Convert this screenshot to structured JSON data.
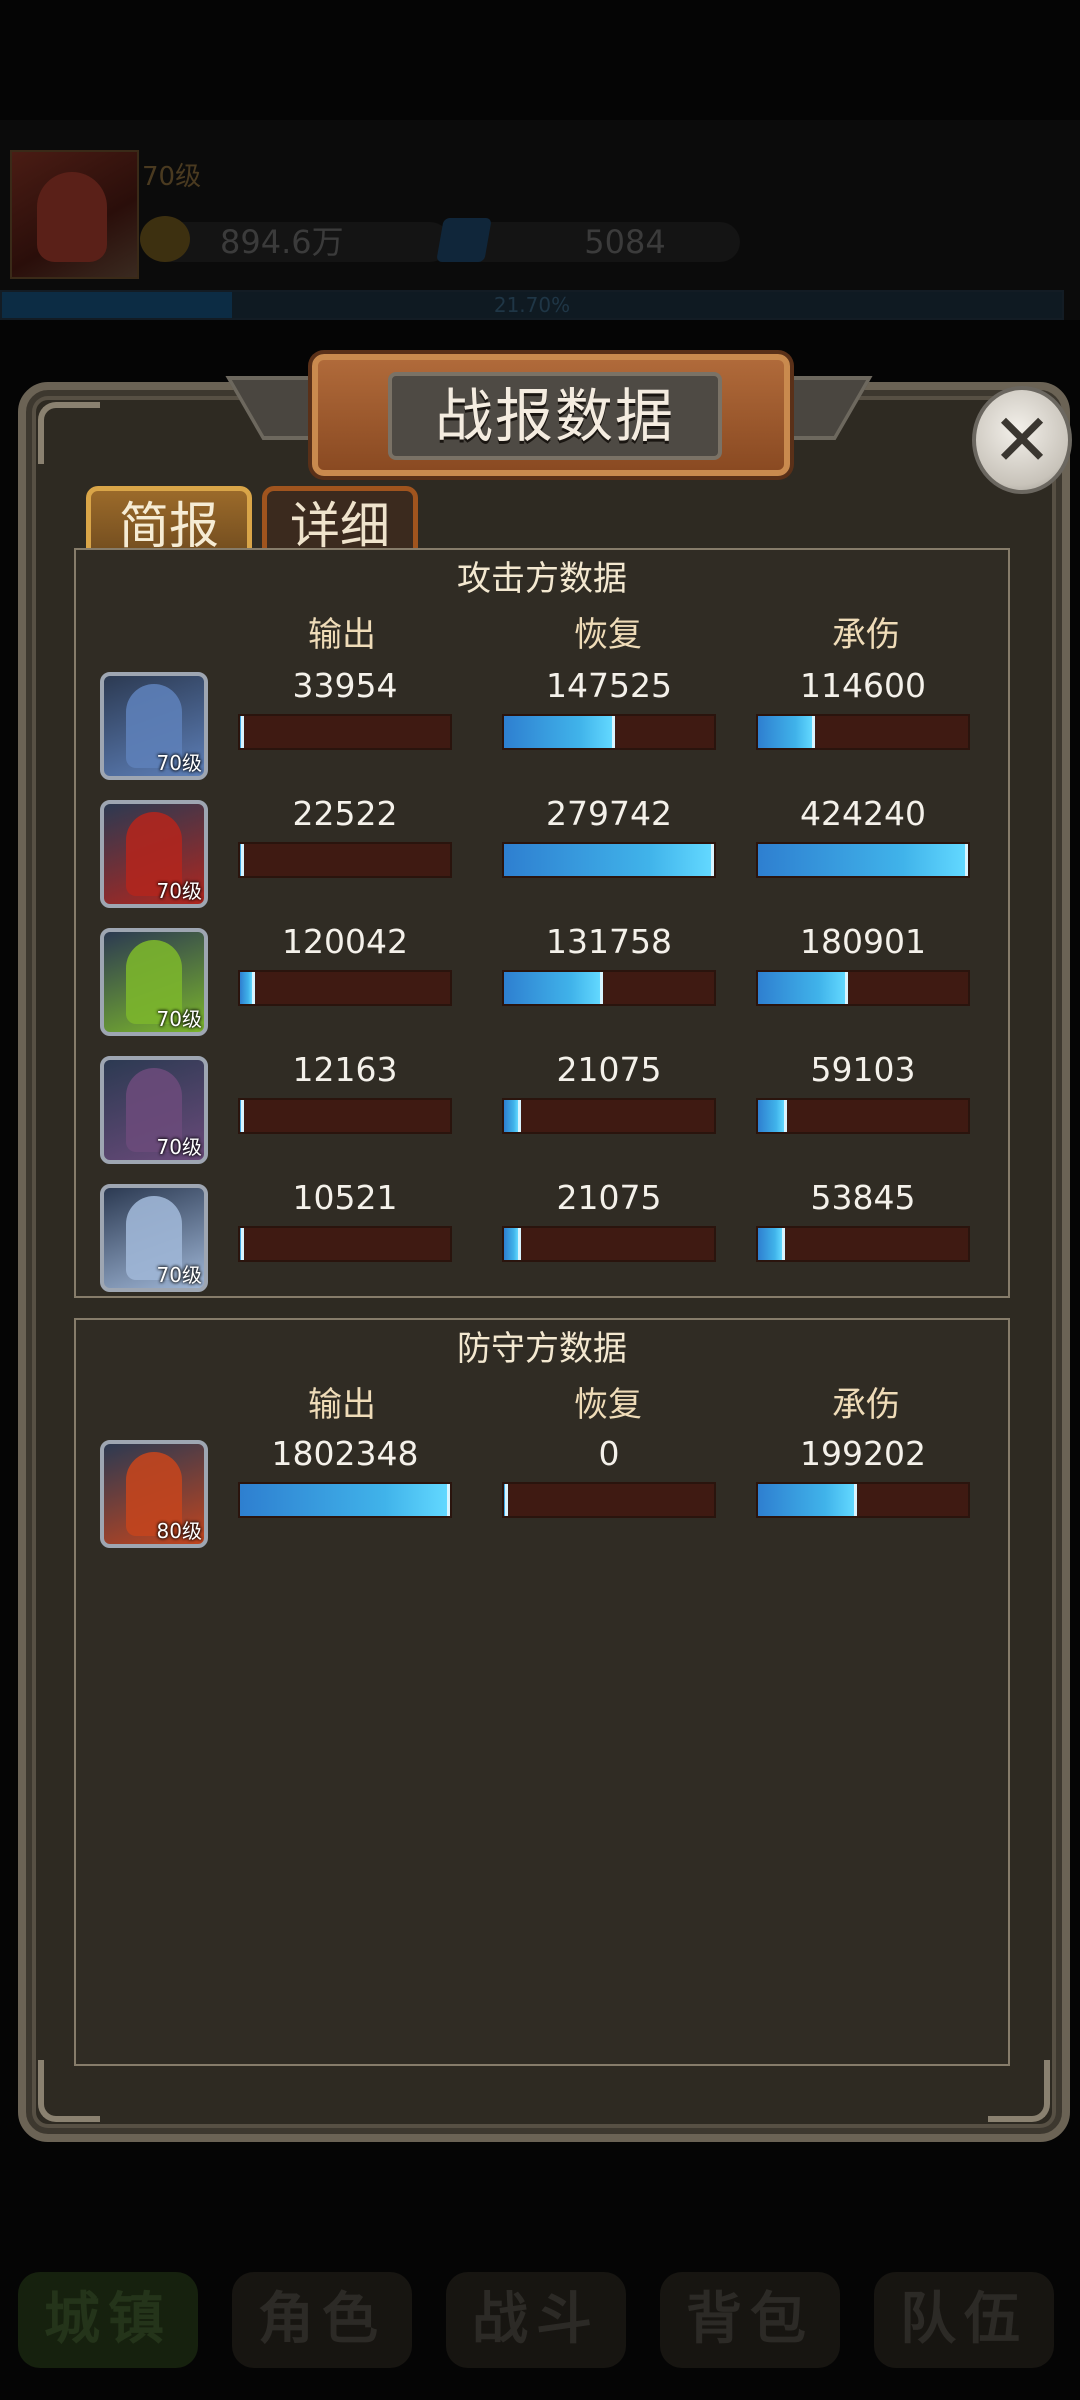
{
  "hud": {
    "level": "70级",
    "gold": "894.6万",
    "gems": "5084",
    "xp_text": "21.70%",
    "xp_fraction": 0.217
  },
  "dialog": {
    "title": "战报数据",
    "close_icon": "close-icon",
    "tabs": [
      {
        "label": "简报",
        "active": true
      },
      {
        "label": "详细",
        "active": false
      }
    ],
    "attacker": {
      "title": "攻击方数据",
      "columns": [
        "输出",
        "恢复",
        "承伤"
      ],
      "rows": [
        {
          "level": "70级",
          "portrait_color": "#5d7fb8",
          "stats": [
            {
              "value": "33954",
              "fill": 0.02
            },
            {
              "value": "147525",
              "fill": 0.53
            },
            {
              "value": "114600",
              "fill": 0.27
            }
          ]
        },
        {
          "level": "70级",
          "portrait_color": "#b0261e",
          "stats": [
            {
              "value": "22522",
              "fill": 0.01
            },
            {
              "value": "279742",
              "fill": 1.0
            },
            {
              "value": "424240",
              "fill": 1.0
            }
          ]
        },
        {
          "level": "70级",
          "portrait_color": "#7bb52c",
          "stats": [
            {
              "value": "120042",
              "fill": 0.07
            },
            {
              "value": "131758",
              "fill": 0.47
            },
            {
              "value": "180901",
              "fill": 0.43
            }
          ]
        },
        {
          "level": "70级",
          "portrait_color": "#6a4a7a",
          "stats": [
            {
              "value": "12163",
              "fill": 0.01
            },
            {
              "value": "21075",
              "fill": 0.08
            },
            {
              "value": "59103",
              "fill": 0.14
            }
          ]
        },
        {
          "level": "70级",
          "portrait_color": "#9fb6d6",
          "stats": [
            {
              "value": "10521",
              "fill": 0.01
            },
            {
              "value": "21075",
              "fill": 0.08
            },
            {
              "value": "53845",
              "fill": 0.13
            }
          ]
        }
      ]
    },
    "defender": {
      "title": "防守方数据",
      "columns": [
        "输出",
        "恢复",
        "承伤"
      ],
      "rows": [
        {
          "level": "80级",
          "portrait_color": "#c2451e",
          "stats": [
            {
              "value": "1802348",
              "fill": 1.0
            },
            {
              "value": "0",
              "fill": 0.0
            },
            {
              "value": "199202",
              "fill": 0.47
            }
          ]
        }
      ]
    }
  },
  "nav": [
    "城镇",
    "角色",
    "战斗",
    "背包",
    "队伍"
  ]
}
